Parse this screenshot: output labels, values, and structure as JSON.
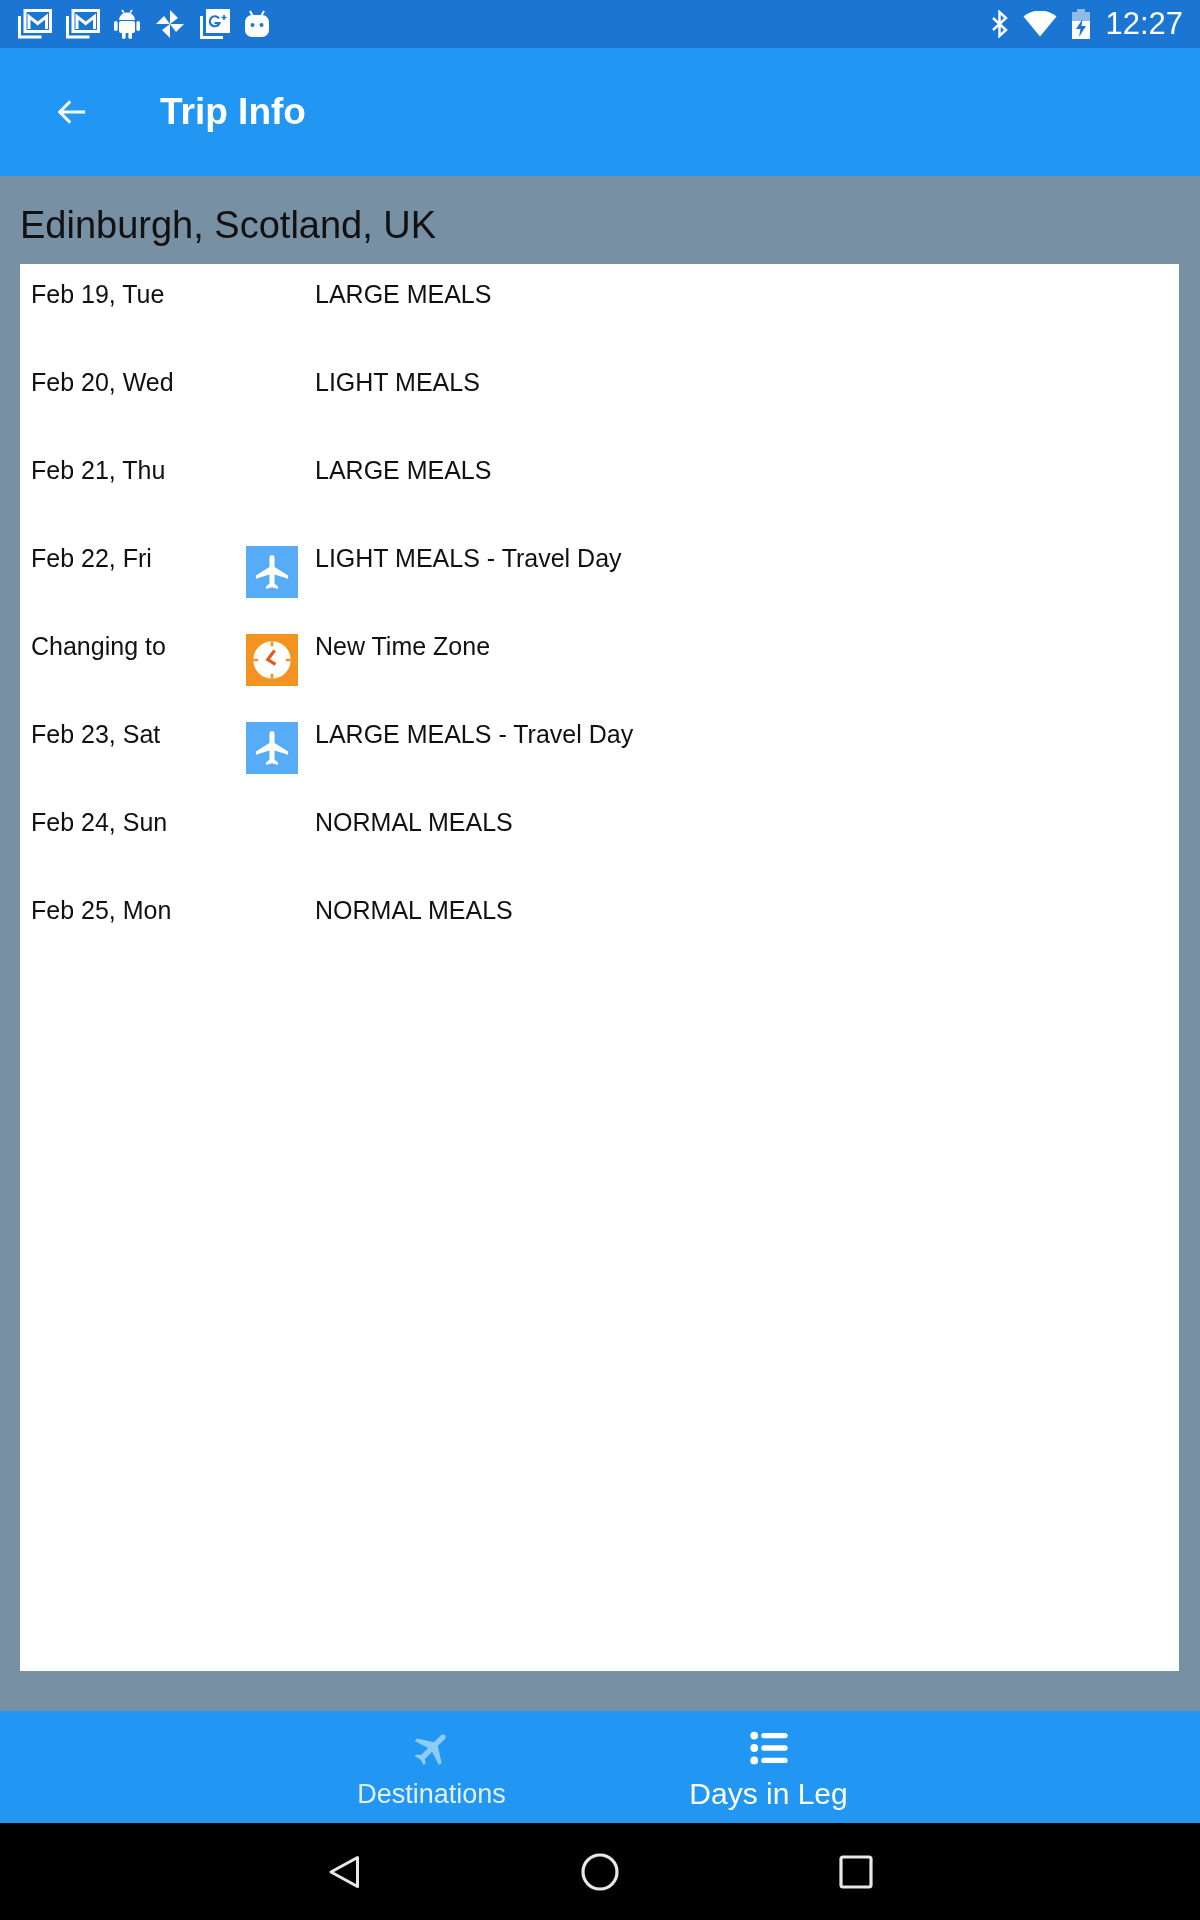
{
  "status_bar": {
    "time": "12:27"
  },
  "app_bar": {
    "title": "Trip Info"
  },
  "destination": {
    "title": "Edinburgh, Scotland, UK",
    "days": [
      {
        "date": "Feb 19, Tue",
        "kind": "plain",
        "plan": "LARGE MEALS"
      },
      {
        "date": "Feb 20, Wed",
        "kind": "plain",
        "plan": "LIGHT MEALS"
      },
      {
        "date": "Feb 21, Thu",
        "kind": "plain",
        "plan": "LARGE MEALS"
      },
      {
        "date": "Feb 22, Fri",
        "kind": "travel",
        "plan": "LIGHT MEALS - Travel Day"
      },
      {
        "date": "Changing to",
        "kind": "timezone",
        "plan": "New Time Zone"
      },
      {
        "date": "Feb 23, Sat",
        "kind": "travel",
        "plan": "LARGE MEALS - Travel Day"
      },
      {
        "date": "Feb 24, Sun",
        "kind": "plain",
        "plan": "NORMAL MEALS"
      },
      {
        "date": "Feb 25, Mon",
        "kind": "plain",
        "plan": "NORMAL MEALS"
      }
    ]
  },
  "bottom_tabs": [
    {
      "label": "Destinations",
      "kind": "plane",
      "selected": false
    },
    {
      "label": "Days in Leg",
      "kind": "list",
      "selected": true
    }
  ]
}
